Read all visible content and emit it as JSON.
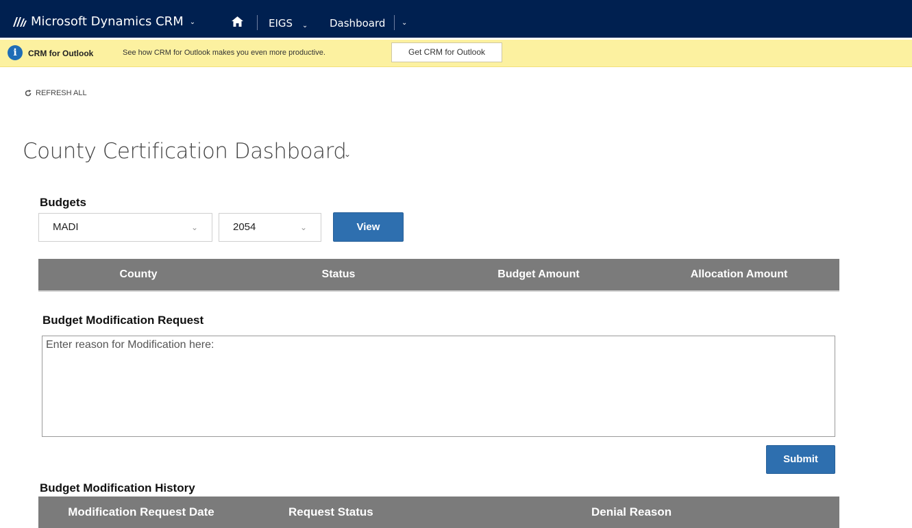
{
  "topnav": {
    "brand": "Microsoft Dynamics CRM",
    "org": "EIGS",
    "area": "Dashboard",
    "bg_color": "#002050"
  },
  "notification": {
    "title": "CRM for Outlook",
    "text": "See how CRM for Outlook makes you even more productive.",
    "button_label": "Get CRM for Outlook",
    "bg_color": "#fcf1a0"
  },
  "toolbar": {
    "refresh_label": "REFRESH ALL"
  },
  "dashboard": {
    "title": "County Certification Dashboard"
  },
  "budgets": {
    "label": "Budgets",
    "program_value": "MADI",
    "year_value": "2054",
    "view_label": "View",
    "columns": [
      "County",
      "Status",
      "Budget Amount",
      "Allocation Amount"
    ]
  },
  "modification_request": {
    "label": "Budget Modification Request",
    "placeholder": "Enter reason for Modification here:",
    "submit_label": "Submit"
  },
  "modification_history": {
    "label": "Budget Modification History",
    "columns": [
      "Modification Request Date",
      "Request Status",
      "Denial Reason"
    ]
  },
  "colors": {
    "accent_blue": "#2e6faf",
    "grid_header": "#7b7b7b"
  }
}
